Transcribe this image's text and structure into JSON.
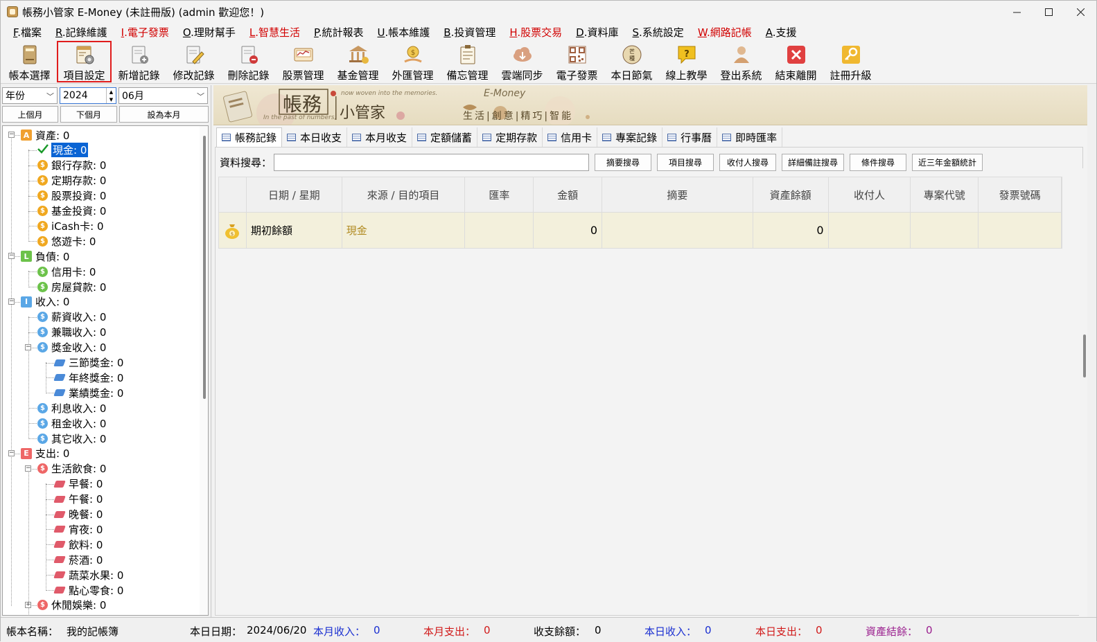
{
  "window": {
    "title": "帳務小管家 E-Money (未註冊版) (admin 歡迎您！)"
  },
  "menu": [
    {
      "key": "F",
      "label": ".檔案",
      "red": false
    },
    {
      "key": "R",
      "label": ".記錄維護",
      "red": false
    },
    {
      "key": "I",
      "label": ".電子發票",
      "red": true
    },
    {
      "key": "O",
      "label": ".理財幫手",
      "red": false
    },
    {
      "key": "L",
      "label": ".智慧生活",
      "red": true
    },
    {
      "key": "P",
      "label": ".統計報表",
      "red": false
    },
    {
      "key": "U",
      "label": ".帳本維護",
      "red": false
    },
    {
      "key": "B",
      "label": ".投資管理",
      "red": false
    },
    {
      "key": "H",
      "label": ".股票交易",
      "red": true
    },
    {
      "key": "D",
      "label": ".資料庫",
      "red": false
    },
    {
      "key": "S",
      "label": ".系統設定",
      "red": false
    },
    {
      "key": "W",
      "label": ".網路記帳",
      "red": true
    },
    {
      "key": "A",
      "label": ".支援",
      "red": false
    }
  ],
  "toolbar": [
    {
      "label": "帳本選擇",
      "icon": "ledger-book-icon"
    },
    {
      "label": "項目設定",
      "icon": "item-settings-icon"
    },
    {
      "label": "新增記錄",
      "icon": "add-record-icon"
    },
    {
      "label": "修改記錄",
      "icon": "edit-record-icon"
    },
    {
      "label": "刪除記錄",
      "icon": "delete-record-icon"
    },
    {
      "label": "股票管理",
      "icon": "stock-icon"
    },
    {
      "label": "基金管理",
      "icon": "fund-icon"
    },
    {
      "label": "外匯管理",
      "icon": "forex-icon"
    },
    {
      "label": "備忘管理",
      "icon": "memo-icon"
    },
    {
      "label": "雲端同步",
      "icon": "cloud-sync-icon"
    },
    {
      "label": "電子發票",
      "icon": "qr-code-icon"
    },
    {
      "label": "本日節氣",
      "icon": "solar-term-icon"
    },
    {
      "label": "線上教學",
      "icon": "help-icon"
    },
    {
      "label": "登出系統",
      "icon": "user-logout-icon"
    },
    {
      "label": "結束離開",
      "icon": "exit-icon"
    },
    {
      "label": "註冊升級",
      "icon": "key-icon"
    }
  ],
  "date_filter": {
    "period": "年份",
    "year": "2024",
    "month": "06月",
    "prev_month": "上個月",
    "next_month": "下個月",
    "set_current": "設為本月"
  },
  "tree": {
    "assets": "資產: 0",
    "cash": "現金: 0",
    "bank": "銀行存款: 0",
    "term_deposit": "定期存款: 0",
    "stock": "股票投資: 0",
    "fund": "基金投資: 0",
    "icash": "iCash卡: 0",
    "easycard": "悠遊卡: 0",
    "liabilities": "負債: 0",
    "credit": "信用卡: 0",
    "mortgage": "房屋貸款: 0",
    "income": "收入: 0",
    "salary": "薪資收入: 0",
    "parttime": "兼職收入: 0",
    "bonus": "獎金收入: 0",
    "festival_bonus": "三節獎金: 0",
    "yearend_bonus": "年終獎金: 0",
    "perf_bonus": "業績獎金: 0",
    "interest": "利息收入: 0",
    "rent": "租金收入: 0",
    "other_income": "其它收入: 0",
    "expense": "支出: 0",
    "food": "生活飲食: 0",
    "breakfast": "早餐: 0",
    "lunch": "午餐: 0",
    "dinner": "晚餐: 0",
    "midnight": "宵夜: 0",
    "drinks": "飲料: 0",
    "tobacco": "菸酒: 0",
    "vegfruit": "蔬菜水果: 0",
    "snacks": "點心零食: 0",
    "leisure": "休閒娛樂: 0"
  },
  "banner": {
    "title1": "帳務",
    "title2": "小管家",
    "eng1": "now woven into the memories.",
    "eng2": "In the past of numbers,",
    "brand": "E-Money",
    "slogan": "生活|創意|精巧|智能"
  },
  "tabs": [
    "帳務記錄",
    "本日收支",
    "本月收支",
    "定額儲蓄",
    "定期存款",
    "信用卡",
    "專案記錄",
    "行事曆",
    "即時匯率"
  ],
  "search": {
    "label": "資料搜尋：",
    "value": "",
    "buttons": [
      "摘要搜尋",
      "項目搜尋",
      "收付人搜尋",
      "詳細備註搜尋",
      "條件搜尋",
      "近三年金額統計"
    ]
  },
  "grid": {
    "headers": [
      "日期 / 星期",
      "來源 / 目的項目",
      "匯率",
      "金額",
      "摘要",
      "資產餘額",
      "收付人",
      "專案代號",
      "發票號碼"
    ],
    "rows": [
      {
        "date": "期初餘額",
        "item": "現金",
        "rate": "",
        "amount": "0",
        "summary": "",
        "balance": "0",
        "payee": "",
        "project": "",
        "invoice": ""
      }
    ]
  },
  "status": {
    "book_label": "帳本名稱：",
    "book_name": "我的記帳簿",
    "date_label": "本日日期：",
    "date_value": "2024/06/20",
    "month_income_label": "本月收入：",
    "month_income": "0",
    "month_expense_label": "本月支出：",
    "month_expense": "0",
    "net_label": "收支餘額：",
    "net": "0",
    "day_income_label": "本日收入：",
    "day_income": "0",
    "day_expense_label": "本日支出：",
    "day_expense": "0",
    "asset_label": "資產結餘：",
    "asset": "0"
  },
  "colors": {
    "accent_red": "#d10000",
    "selection_blue": "#0a64d4",
    "asset_orange": "#f0a030",
    "liability_green": "#6cc24a",
    "income_blue": "#5aa7e6",
    "expense_red": "#ee6666",
    "row_highlight": "#f3f0dc"
  }
}
